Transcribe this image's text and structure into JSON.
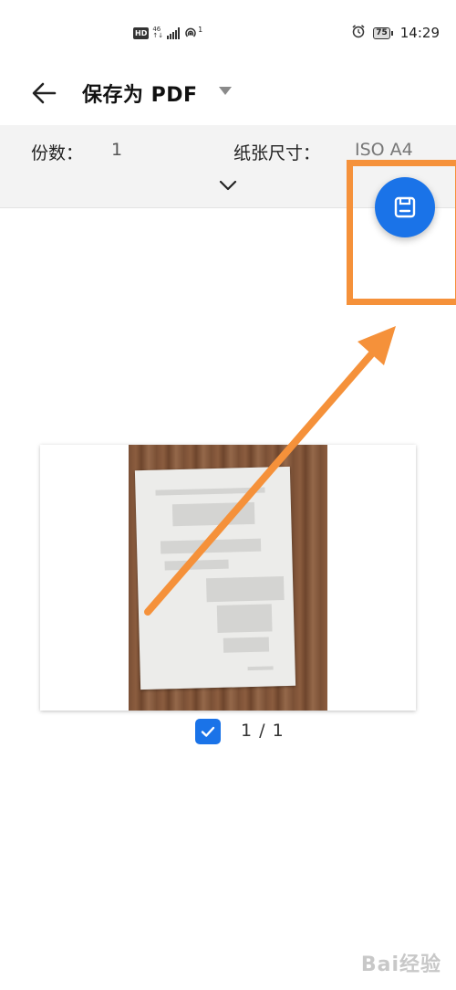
{
  "status_bar": {
    "hd": "HD",
    "network_top": "46",
    "network_bottom": "↑↓",
    "hotspot_count": "1",
    "battery": "75",
    "time": "14:29"
  },
  "app_bar": {
    "title": "保存为 PDF"
  },
  "settings": {
    "copies_label": "份数：",
    "copies_value": "1",
    "paper_size_label": "纸张尺寸：",
    "paper_size_value": "ISO A4"
  },
  "preview": {
    "page_counter": "1 / 1",
    "selected": true
  },
  "watermark": {
    "text": "Bai经验"
  },
  "colors": {
    "accent": "#1a73e8",
    "annotation": "#f5913a"
  }
}
